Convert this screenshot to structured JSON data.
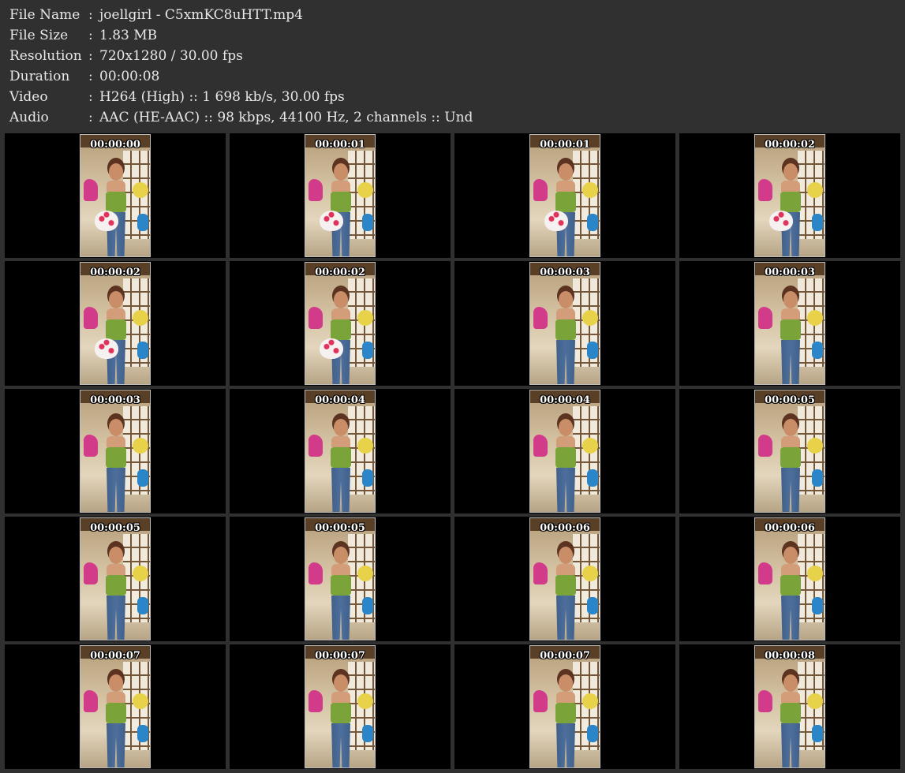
{
  "info": {
    "rows": [
      {
        "label": "File Name",
        "sep": ":",
        "value": "joellgirl - C5xmKC8uHTT.mp4"
      },
      {
        "label": "File Size",
        "sep": ":",
        "value": "1.83 MB"
      },
      {
        "label": "Resolution",
        "sep": ":",
        "value": "720x1280 / 30.00 fps"
      },
      {
        "label": "Duration",
        "sep": ":",
        "value": "00:00:08"
      },
      {
        "label": "Video",
        "sep": ":",
        "value": "H264 (High) :: 1 698 kb/s, 30.00 fps"
      },
      {
        "label": "Audio",
        "sep": ":",
        "value": "AAC (HE-AAC) :: 98 kbps, 44100 Hz, 2 channels :: Und"
      }
    ]
  },
  "thumbnails": [
    {
      "timestamp": "00:00:00"
    },
    {
      "timestamp": "00:00:01"
    },
    {
      "timestamp": "00:00:01"
    },
    {
      "timestamp": "00:00:02"
    },
    {
      "timestamp": "00:00:02"
    },
    {
      "timestamp": "00:00:02"
    },
    {
      "timestamp": "00:00:03"
    },
    {
      "timestamp": "00:00:03"
    },
    {
      "timestamp": "00:00:03"
    },
    {
      "timestamp": "00:00:04"
    },
    {
      "timestamp": "00:00:04"
    },
    {
      "timestamp": "00:00:05"
    },
    {
      "timestamp": "00:00:05"
    },
    {
      "timestamp": "00:00:05"
    },
    {
      "timestamp": "00:00:06"
    },
    {
      "timestamp": "00:00:06"
    },
    {
      "timestamp": "00:00:07"
    },
    {
      "timestamp": "00:00:07"
    },
    {
      "timestamp": "00:00:07"
    },
    {
      "timestamp": "00:00:08"
    }
  ],
  "colors": {
    "background": "#303030",
    "text": "#e8e8e8",
    "cell": "#000000",
    "timestamp": "#ffffff"
  }
}
